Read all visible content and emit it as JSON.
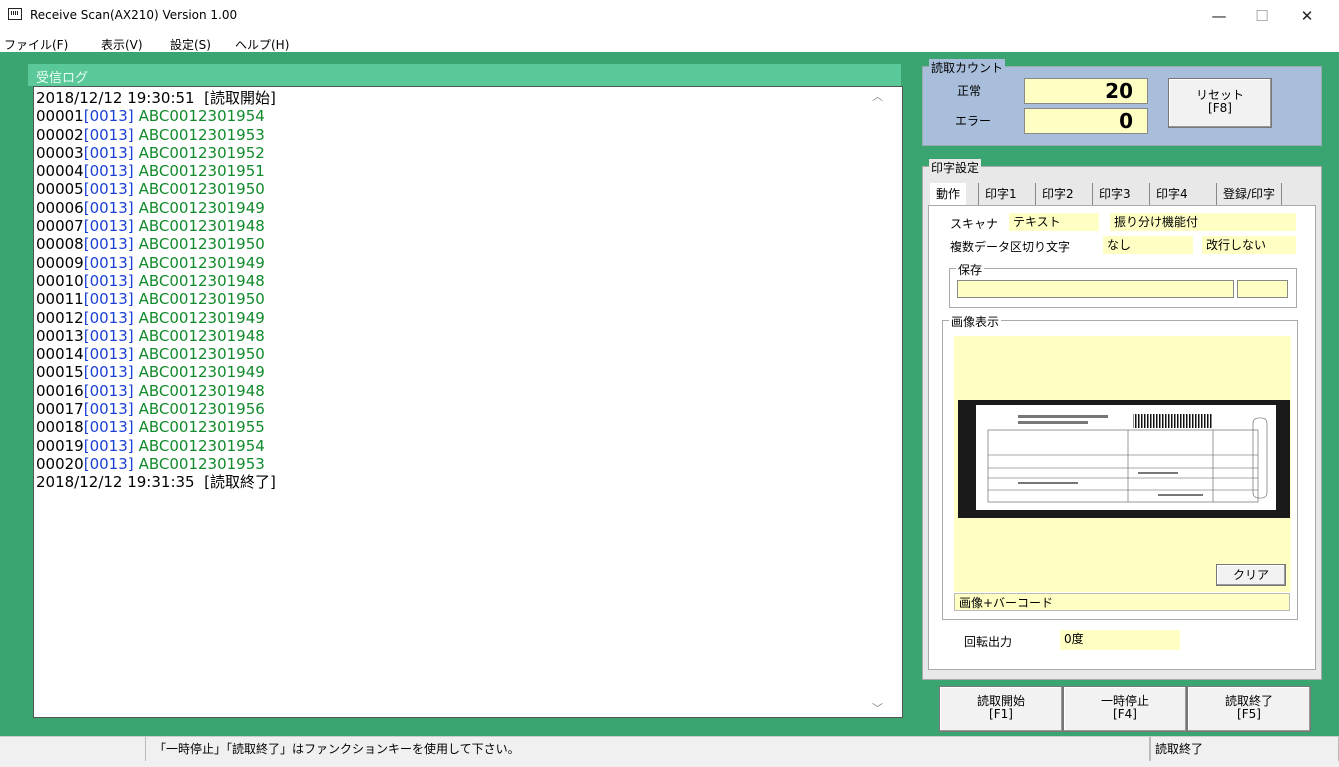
{
  "window": {
    "title": "Receive Scan(AX210) Version 1.00",
    "minimize": "—",
    "maximize": "☐",
    "close": "✕"
  },
  "menu": [
    "ファイル(F)",
    "表示(V)",
    "設定(S)",
    "ヘルプ(H)"
  ],
  "log": {
    "title": "受信ログ",
    "start_line": "2018/12/12 19:30:51  [読取開始]",
    "end_line": "2018/12/12 19:31:35  [読取終了]",
    "entries": [
      {
        "no": "00001",
        "len": "[0013]",
        "code": "ABC0012301954"
      },
      {
        "no": "00002",
        "len": "[0013]",
        "code": "ABC0012301953"
      },
      {
        "no": "00003",
        "len": "[0013]",
        "code": "ABC0012301952"
      },
      {
        "no": "00004",
        "len": "[0013]",
        "code": "ABC0012301951"
      },
      {
        "no": "00005",
        "len": "[0013]",
        "code": "ABC0012301950"
      },
      {
        "no": "00006",
        "len": "[0013]",
        "code": "ABC0012301949"
      },
      {
        "no": "00007",
        "len": "[0013]",
        "code": "ABC0012301948"
      },
      {
        "no": "00008",
        "len": "[0013]",
        "code": "ABC0012301950"
      },
      {
        "no": "00009",
        "len": "[0013]",
        "code": "ABC0012301949"
      },
      {
        "no": "00010",
        "len": "[0013]",
        "code": "ABC0012301948"
      },
      {
        "no": "00011",
        "len": "[0013]",
        "code": "ABC0012301950"
      },
      {
        "no": "00012",
        "len": "[0013]",
        "code": "ABC0012301949"
      },
      {
        "no": "00013",
        "len": "[0013]",
        "code": "ABC0012301948"
      },
      {
        "no": "00014",
        "len": "[0013]",
        "code": "ABC0012301950"
      },
      {
        "no": "00015",
        "len": "[0013]",
        "code": "ABC0012301949"
      },
      {
        "no": "00016",
        "len": "[0013]",
        "code": "ABC0012301948"
      },
      {
        "no": "00017",
        "len": "[0013]",
        "code": "ABC0012301956"
      },
      {
        "no": "00018",
        "len": "[0013]",
        "code": "ABC0012301955"
      },
      {
        "no": "00019",
        "len": "[0013]",
        "code": "ABC0012301954"
      },
      {
        "no": "00020",
        "len": "[0013]",
        "code": "ABC0012301953"
      }
    ]
  },
  "count": {
    "title": "読取カウント",
    "normal_label": "正常",
    "normal_value": "20",
    "error_label": "エラー",
    "error_value": "0",
    "reset_label": "リセット",
    "reset_key": "[F8]"
  },
  "print": {
    "title": "印字設定",
    "tabs": [
      "動作",
      "印字1",
      "印字2",
      "印字3",
      "印字4",
      "登録/印字"
    ],
    "scanner_label": "スキャナ",
    "scanner_value": "テキスト",
    "scanner_option": "振り分け機能付",
    "sep_label": "複数データ区切り文字",
    "sep_value": "なし",
    "sep_option": "改行しない",
    "save_title": "保存",
    "save_path": "",
    "save_ext": "",
    "image_title": "画像表示",
    "clear_label": "クリア",
    "image_mode": "画像+バーコード",
    "rotate_label": "回転出力",
    "rotate_value": "0度"
  },
  "actions": {
    "start": "読取開始",
    "start_key": "[F1]",
    "pause": "一時停止",
    "pause_key": "[F4]",
    "end": "読取終了",
    "end_key": "[F5]"
  },
  "status": {
    "message": "「一時停止」「読取終了」はファンクションキーを使用して下さい。",
    "state": "読取終了"
  },
  "colors": {
    "frame": "#3aa571",
    "log_header": "#5bc89a",
    "count_bg": "#a9bedb",
    "field_bg": "#ffffc4"
  }
}
